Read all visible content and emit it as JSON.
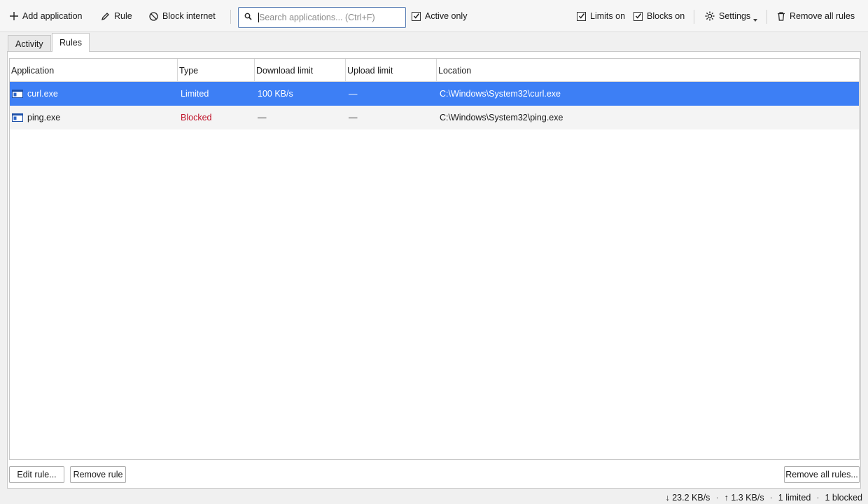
{
  "toolbar": {
    "add_application": "Add application",
    "rule": "Rule",
    "block_internet": "Block internet",
    "search_placeholder": "Search applications...  (Ctrl+F)",
    "active_only": "Active only",
    "limits_on": "Limits on",
    "blocks_on": "Blocks on",
    "settings": "Settings",
    "remove_all_rules": "Remove all rules",
    "active_only_checked": true,
    "limits_on_checked": true,
    "blocks_on_checked": true
  },
  "tabs": [
    {
      "label": "Activity",
      "active": false
    },
    {
      "label": "Rules",
      "active": true
    }
  ],
  "table": {
    "columns": [
      "Application",
      "Type",
      "Download limit",
      "Upload limit",
      "Location"
    ],
    "rows": [
      {
        "application": "curl.exe",
        "type": "Limited",
        "download": "100 KB/s",
        "upload": "—",
        "location": "C:\\Windows\\System32\\curl.exe",
        "selected": true
      },
      {
        "application": "ping.exe",
        "type": "Blocked",
        "download": "—",
        "upload": "—",
        "location": "C:\\Windows\\System32\\ping.exe",
        "selected": false
      }
    ]
  },
  "buttons": {
    "edit_rule": "Edit rule...",
    "remove_rule": "Remove rule",
    "remove_all_rules": "Remove all rules..."
  },
  "status": {
    "download": "↓ 23.2 KB/s",
    "upload": "↑ 1.3 KB/s",
    "limited": "1 limited",
    "blocked": "1 blocked",
    "separator": "·"
  },
  "colors": {
    "selection": "#3d7ff5",
    "blocked": "#c0142a"
  }
}
